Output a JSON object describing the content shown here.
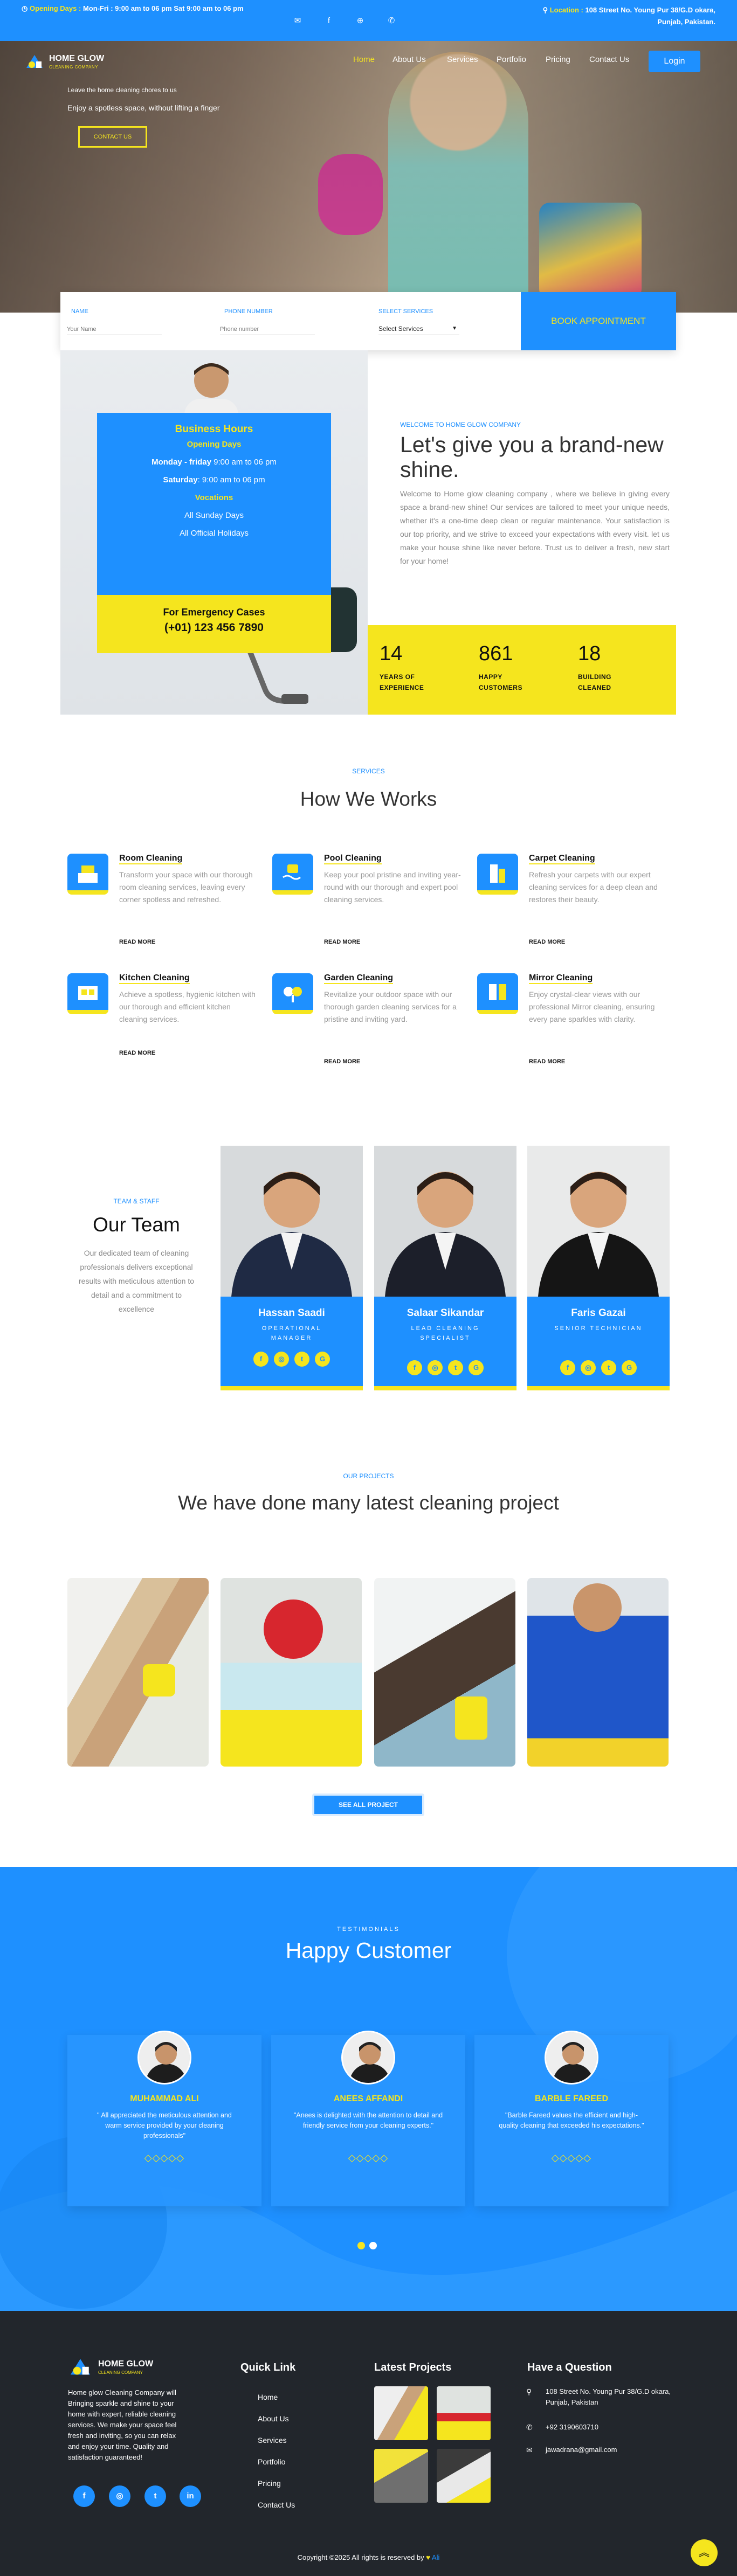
{
  "topbar": {
    "hours_label": "Opening Days : ",
    "hours_value": "Mon-Fri : 9:00 am to 06 pm Sat 9:00 am to 06 pm",
    "location_label": "Location : ",
    "location_value": "108 Street No. Young Pur 38/G.D okara, Punjab, Pakistan."
  },
  "brand": {
    "name": "HOME GLOW",
    "tagline": "CLEANING COMPANY"
  },
  "nav": {
    "items": [
      "Home",
      "About Us",
      "Services",
      "Portfolio",
      "Pricing",
      "Contact Us"
    ],
    "login": "Login"
  },
  "hero": {
    "line1": "Leave the home cleaning chores to us",
    "line2": "Enjoy a spotless space, without lifting a finger",
    "cta": "CONTACT US"
  },
  "booking": {
    "name_label": "NAME",
    "name_placeholder": "Your Name",
    "phone_label": "PHONE NUMBER",
    "phone_placeholder": "Phone number",
    "service_label": "SELECT SERVICES",
    "service_value": "Select Services",
    "button": "BOOK APPOINTMENT"
  },
  "hours": {
    "title": "Business Hours",
    "opening": "Opening Days",
    "weekday_label": "Monday - friday",
    "weekday_value": " 9:00 am to 06 pm",
    "saturday_label": "Saturday",
    "saturday_value": ": 9:00 am to 06 pm",
    "vacations_label": "Vocations",
    "vacation1": "All Sunday Days",
    "vacation2": "All Official Holidays",
    "emergency_label": "For Emergency Cases",
    "emergency_phone": "(+01) 123 456 7890"
  },
  "about": {
    "eyebrow": "WELCOME TO HOME GLOW COMPANY",
    "heading": "Let's give you a brand-new shine.",
    "body": "Welcome to Home glow cleaning company , where we believe in giving every space a brand-new shine! Our services are tailored to meet your unique needs, whether it's a one-time deep clean or regular maintenance. Your satisfaction is our top priority, and we strive to exceed your expectations with every visit. let us make your house shine like never before. Trust us to deliver a fresh, new start for your home!"
  },
  "stats": [
    {
      "value": "14",
      "label1": "YEARS OF",
      "label2": "EXPERIENCE"
    },
    {
      "value": "861",
      "label1": "HAPPY",
      "label2": "CUSTOMERS"
    },
    {
      "value": "18",
      "label1": "BUILDING",
      "label2": "CLEANED"
    }
  ],
  "services": {
    "eyebrow": "SERVICES",
    "heading": "How We Works",
    "read_more": "READ MORE",
    "items": [
      {
        "title": "Room Cleaning",
        "desc": "Transform your space with our thorough room cleaning services, leaving every corner spotless and refreshed.",
        "icon": "room-icon"
      },
      {
        "title": "Pool Cleaning",
        "desc": "Keep your pool pristine and inviting year-round with our thorough and expert pool cleaning services.",
        "icon": "pool-icon"
      },
      {
        "title": "Carpet Cleaning",
        "desc": "Refresh your carpets with our expert cleaning services for a deep clean and restores their beauty.",
        "icon": "carpet-icon"
      },
      {
        "title": "Kitchen Cleaning",
        "desc": "Achieve a spotless, hygienic kitchen with our thorough and efficient kitchen cleaning services.",
        "icon": "kitchen-icon"
      },
      {
        "title": "Garden Cleaning",
        "desc": "Revitalize your outdoor space with our thorough garden cleaning services for a pristine and inviting yard.",
        "icon": "garden-icon"
      },
      {
        "title": "Mirror Cleaning",
        "desc": "Enjoy crystal-clear views with our professional Mirror cleaning, ensuring every pane sparkles with clarity.",
        "icon": "mirror-icon"
      }
    ]
  },
  "team": {
    "eyebrow": "TEAM & STAFF",
    "heading": "Our Team",
    "body": "Our dedicated team of cleaning professionals delivers exceptional results with meticulous attention to detail and a commitment to excellence",
    "members": [
      {
        "name": "Hassan Saadi",
        "role": "OPERATIONAL MANAGER"
      },
      {
        "name": "Salaar Sikandar",
        "role": "LEAD CLEANING SPECIALIST"
      },
      {
        "name": "Faris Gazai",
        "role": "SENIOR TECHNICIAN"
      }
    ]
  },
  "projects": {
    "eyebrow": "OUR PROJECTS",
    "heading": "We have done many latest cleaning project",
    "button": "SEE ALL PROJECT"
  },
  "testimonials": {
    "eyebrow": "TESTIMONIALS",
    "heading": "Happy Customer",
    "items": [
      {
        "name": "MUHAMMAD ALI",
        "quote": "\" All appreciated the meticulous attention and warm service provided by your cleaning professionals\""
      },
      {
        "name": "ANEES AFFANDI",
        "quote": "\"Anees is delighted with the attention to detail and friendly service from your cleaning experts.\""
      },
      {
        "name": "BARBLE FAREED",
        "quote": "\"Barble Fareed values the efficient and high-quality cleaning that exceeded his expectations.\""
      }
    ],
    "stars": "◇◇◇◇◇"
  },
  "footer": {
    "about": "Home glow Cleaning Company will Bringing sparkle and shine to your home with expert, reliable cleaning services. We make your space feel fresh and inviting, so you can relax and enjoy your time. Quality and satisfaction guaranteed!",
    "quick_title": "Quick Link",
    "links": [
      "Home",
      "About Us",
      "Services",
      "Portfolio",
      "Pricing",
      "Contact Us"
    ],
    "projects_title": "Latest Projects",
    "question_title": "Have a Question",
    "address": "108 Street No. Young Pur 38/G.D okara, Punjab, Pakistan",
    "phone": "+92 3190603710",
    "email": "jawadrana@gmail.com",
    "copyright": "Copyright ©2025 All rights is reserved by",
    "copyright_by": "Ali"
  },
  "colors": {
    "primary": "#1e90ff",
    "accent": "#f5e51e",
    "footer": "#22262c"
  }
}
